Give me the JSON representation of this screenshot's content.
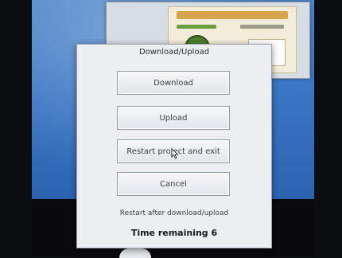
{
  "dialog": {
    "title": "Download/Upload",
    "buttons": {
      "download": "Download",
      "upload": "Upload",
      "restart": "Restart project and exit",
      "cancel": "Cancel"
    },
    "restart_note": "Restart after download/upload",
    "time_remaining": "Time remaining 6"
  },
  "colors": {
    "screen_background": "#3a76c4",
    "dialog_background": "#eceef2"
  }
}
